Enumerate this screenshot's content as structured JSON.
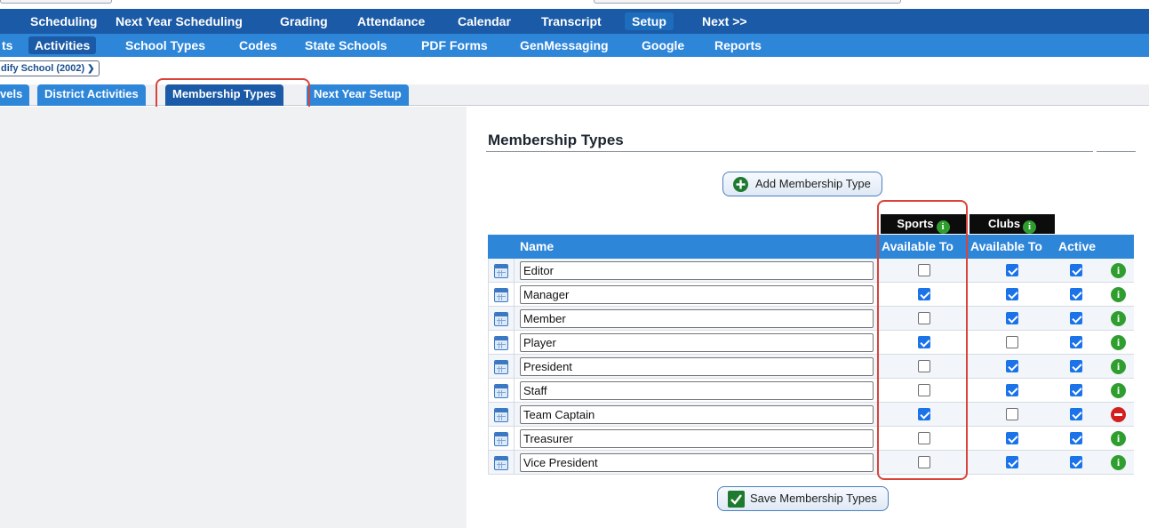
{
  "nav_main": {
    "items": [
      {
        "label": "Scheduling",
        "active": false
      },
      {
        "label": "Next Year Scheduling",
        "active": false
      },
      {
        "label": "Grading",
        "active": false
      },
      {
        "label": "Attendance",
        "active": false
      },
      {
        "label": "Calendar",
        "active": false
      },
      {
        "label": "Transcript",
        "active": false
      },
      {
        "label": "Setup",
        "active": true
      },
      {
        "label": "Next >>",
        "active": false
      }
    ]
  },
  "nav_sub": {
    "items": [
      {
        "label": "ts",
        "active": false
      },
      {
        "label": "Activities",
        "active": true
      },
      {
        "label": "School Types",
        "active": false
      },
      {
        "label": "Codes",
        "active": false
      },
      {
        "label": "State Schools",
        "active": false
      },
      {
        "label": "PDF Forms",
        "active": false
      },
      {
        "label": "GenMessaging",
        "active": false
      },
      {
        "label": "Google",
        "active": false
      },
      {
        "label": "Reports",
        "active": false
      }
    ]
  },
  "school_selector": {
    "value": "dify School (2002)"
  },
  "tabs": [
    {
      "label": "vels",
      "active": false
    },
    {
      "label": "District Activities",
      "active": false
    },
    {
      "label": "Membership Types",
      "active": true
    },
    {
      "label": "Next Year Setup",
      "active": false
    }
  ],
  "section": {
    "title": "Membership Types"
  },
  "add_button": {
    "label": "Add Membership Type"
  },
  "save_button": {
    "label": "Save Membership Types"
  },
  "groups": {
    "sports": "Sports",
    "clubs": "Clubs"
  },
  "columns": {
    "name": "Name",
    "sports_available": "Available To",
    "clubs_available": "Available To",
    "active": "Active"
  },
  "rows": [
    {
      "name": "Editor",
      "sports": false,
      "clubs": true,
      "active": true,
      "status": "info"
    },
    {
      "name": "Manager",
      "sports": true,
      "clubs": true,
      "active": true,
      "status": "info"
    },
    {
      "name": "Member",
      "sports": false,
      "clubs": true,
      "active": true,
      "status": "info"
    },
    {
      "name": "Player",
      "sports": true,
      "clubs": false,
      "active": true,
      "status": "info"
    },
    {
      "name": "President",
      "sports": false,
      "clubs": true,
      "active": true,
      "status": "info"
    },
    {
      "name": "Staff",
      "sports": false,
      "clubs": true,
      "active": true,
      "status": "info"
    },
    {
      "name": "Team Captain",
      "sports": true,
      "clubs": false,
      "active": true,
      "status": "remove"
    },
    {
      "name": "Treasurer",
      "sports": false,
      "clubs": true,
      "active": true,
      "status": "info"
    },
    {
      "name": "Vice President",
      "sports": false,
      "clubs": true,
      "active": true,
      "status": "info"
    }
  ],
  "colors": {
    "nav_main_bg": "#1a5aa6",
    "nav_sub_bg": "#2e86d9",
    "header_bg": "#2e86d9",
    "highlight": "#d9433a",
    "info_green": "#2f9e2f",
    "remove_red": "#d41f1f"
  },
  "icons": {
    "add": "plus-circle-icon",
    "save": "checkmark-box-icon",
    "info": "info-icon",
    "remove": "minus-circle-icon",
    "row_edit": "calendar-icon",
    "school_select": "chevron-down-icon"
  }
}
